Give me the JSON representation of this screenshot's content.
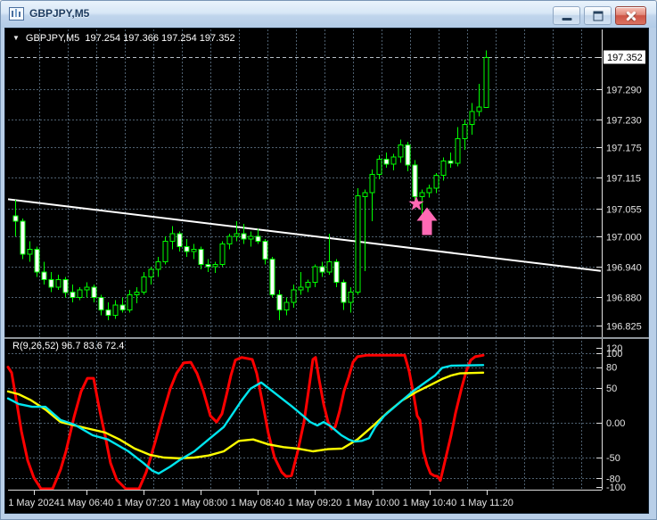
{
  "window": {
    "title": "GBPJPY,M5",
    "icon": "candlestick-chart-icon",
    "controls": [
      {
        "id": "minimize",
        "icon": "minimize-icon"
      },
      {
        "id": "restore",
        "icon": "restore-icon"
      },
      {
        "id": "close",
        "icon": "close-icon"
      }
    ]
  },
  "main_chart": {
    "collapse_glyph": "▼",
    "symbol_line": "GBPJPY,M5  197.254 197.366 197.254 197.352",
    "ohlc": {
      "open": 197.254,
      "high": 197.366,
      "low": 197.254,
      "close": 197.352
    },
    "current_price": "197.352",
    "price_axis_labels": [
      "197.290",
      "197.230",
      "197.175",
      "197.115",
      "197.055",
      "197.000",
      "196.940",
      "196.880",
      "196.825"
    ],
    "trendline": {
      "color": "#FFFFFF",
      "from_price": 197.073,
      "to_price": 196.932
    },
    "markers": {
      "star": {
        "x": 466,
        "y": 227.5,
        "color": "#FF69B4"
      },
      "arrow_up": {
        "x": 478,
        "tip_y": 231.5,
        "color": "#FF69B4"
      }
    }
  },
  "indicator": {
    "label": "R(9,26,52) 96.7 83.6 72.4",
    "values": [
      96.7,
      83.6,
      72.4
    ],
    "axis": [
      {
        "t": "120",
        "v": 120
      },
      {
        "t": "100",
        "v": 100
      },
      {
        "t": "80",
        "v": 80
      },
      {
        "t": "50",
        "v": 50
      },
      {
        "t": "0.00",
        "v": 0
      },
      {
        "t": "-50",
        "v": -50
      },
      {
        "t": "-80",
        "v": -80
      },
      {
        "t": "-100",
        "v": -100
      }
    ]
  },
  "time_axis": {
    "labels": [
      "1 May 2024",
      "1 May 06:40",
      "1 May 07:20",
      "1 May 08:00",
      "1 May 08:40",
      "1 May 09:20",
      "1 May 10:00",
      "1 May 10:40",
      "1 May 11:20"
    ]
  },
  "chart_data": {
    "type": "candlestick",
    "symbol": "GBPJPY",
    "timeframe": "M5",
    "price_range": [
      196.8,
      197.4
    ],
    "candles": [
      [
        197.04,
        197.072,
        197.0,
        197.03
      ],
      [
        197.03,
        197.035,
        196.955,
        196.965
      ],
      [
        196.965,
        196.99,
        196.95,
        196.975
      ],
      [
        196.975,
        196.98,
        196.92,
        196.93
      ],
      [
        196.93,
        196.95,
        196.905,
        196.915
      ],
      [
        196.915,
        196.93,
        196.89,
        196.9
      ],
      [
        196.9,
        196.925,
        196.895,
        196.915
      ],
      [
        196.915,
        196.92,
        196.88,
        196.89
      ],
      [
        196.89,
        196.905,
        196.87,
        196.88
      ],
      [
        196.88,
        196.9,
        196.875,
        196.895
      ],
      [
        196.895,
        196.91,
        196.88,
        196.9
      ],
      [
        196.9,
        196.905,
        196.87,
        196.88
      ],
      [
        196.88,
        196.885,
        196.845,
        196.855
      ],
      [
        196.855,
        196.87,
        196.835,
        196.845
      ],
      [
        196.845,
        196.875,
        196.838,
        196.865
      ],
      [
        196.865,
        196.88,
        196.85,
        196.855
      ],
      [
        196.855,
        196.895,
        196.85,
        196.885
      ],
      [
        196.885,
        196.9,
        196.868,
        196.89
      ],
      [
        196.89,
        196.93,
        196.885,
        196.92
      ],
      [
        196.92,
        196.94,
        196.905,
        196.935
      ],
      [
        196.935,
        196.96,
        196.92,
        196.95
      ],
      [
        196.95,
        197.0,
        196.945,
        196.99
      ],
      [
        196.99,
        197.02,
        196.975,
        197.005
      ],
      [
        197.005,
        197.01,
        196.97,
        196.98
      ],
      [
        196.98,
        196.995,
        196.96,
        196.97
      ],
      [
        196.97,
        196.985,
        196.955,
        196.975
      ],
      [
        196.975,
        196.98,
        196.935,
        196.945
      ],
      [
        196.945,
        196.955,
        196.93,
        196.94
      ],
      [
        196.94,
        196.95,
        196.928,
        196.945
      ],
      [
        196.945,
        196.99,
        196.94,
        196.985
      ],
      [
        196.985,
        197.005,
        196.975,
        197.0
      ],
      [
        197.0,
        197.03,
        196.99,
        197.005
      ],
      [
        197.005,
        197.025,
        196.985,
        196.995
      ],
      [
        196.995,
        197.01,
        196.98,
        197.0
      ],
      [
        197.0,
        197.015,
        196.985,
        196.99
      ],
      [
        196.99,
        196.995,
        196.945,
        196.955
      ],
      [
        196.955,
        196.96,
        196.88,
        196.885
      ],
      [
        196.885,
        196.895,
        196.835,
        196.855
      ],
      [
        196.855,
        196.88,
        196.845,
        196.87
      ],
      [
        196.87,
        196.905,
        196.86,
        196.895
      ],
      [
        196.895,
        196.93,
        196.885,
        196.9
      ],
      [
        196.9,
        196.915,
        196.89,
        196.91
      ],
      [
        196.91,
        196.945,
        196.9,
        196.94
      ],
      [
        196.94,
        196.95,
        196.92,
        196.93
      ],
      [
        196.93,
        197.005,
        196.925,
        196.95
      ],
      [
        196.95,
        196.955,
        196.9,
        196.91
      ],
      [
        196.91,
        196.915,
        196.855,
        196.87
      ],
      [
        196.87,
        196.9,
        196.85,
        196.89
      ],
      [
        196.89,
        197.095,
        196.885,
        197.08
      ],
      [
        197.078,
        197.092,
        196.932,
        197.086
      ],
      [
        197.086,
        197.132,
        197.03,
        197.122
      ],
      [
        197.122,
        197.16,
        197.112,
        197.152
      ],
      [
        197.152,
        197.165,
        197.135,
        197.142
      ],
      [
        197.142,
        197.162,
        197.13,
        197.156
      ],
      [
        197.156,
        197.19,
        197.145,
        197.18
      ],
      [
        197.18,
        197.186,
        197.128,
        197.14
      ],
      [
        197.14,
        197.15,
        197.068,
        197.078
      ],
      [
        197.078,
        197.092,
        197.044,
        197.086
      ],
      [
        197.086,
        197.102,
        197.076,
        197.095
      ],
      [
        197.095,
        197.125,
        197.085,
        197.12
      ],
      [
        197.12,
        197.155,
        197.11,
        197.148
      ],
      [
        197.148,
        197.165,
        197.135,
        197.144
      ],
      [
        197.144,
        197.215,
        197.138,
        197.192
      ],
      [
        197.192,
        197.23,
        197.17,
        197.22
      ],
      [
        197.22,
        197.262,
        197.2,
        197.246
      ],
      [
        197.246,
        197.3,
        197.236,
        197.254
      ],
      [
        197.254,
        197.366,
        197.254,
        197.352
      ]
    ],
    "oscillator": {
      "name": "R(9,26,52)",
      "levels": [
        100,
        80,
        50,
        0,
        -50,
        -80,
        -100
      ],
      "range": [
        -120,
        120
      ],
      "series": [
        {
          "name": "R9",
          "color": "#FF0000",
          "width": 3,
          "points": [
            [
              8,
              80
            ],
            [
              12,
              72
            ],
            [
              18,
              27
            ],
            [
              23,
              -12
            ],
            [
              30,
              -54
            ],
            [
              37,
              -79
            ],
            [
              45,
              -95
            ],
            [
              58,
              -97
            ],
            [
              67,
              -67
            ],
            [
              73,
              -41
            ],
            [
              82,
              8
            ],
            [
              90,
              45
            ],
            [
              97,
              64
            ],
            [
              104,
              64
            ],
            [
              110,
              23
            ],
            [
              117,
              -19
            ],
            [
              123,
              -58
            ],
            [
              130,
              -82
            ],
            [
              140,
              -95
            ],
            [
              155,
              -97
            ],
            [
              163,
              -71
            ],
            [
              173,
              -28
            ],
            [
              182,
              14
            ],
            [
              190,
              49
            ],
            [
              197,
              71
            ],
            [
              205,
              86
            ],
            [
              213,
              87
            ],
            [
              220,
              71
            ],
            [
              227,
              46
            ],
            [
              235,
              10
            ],
            [
              242,
              1
            ],
            [
              248,
              13
            ],
            [
              254,
              45
            ],
            [
              258,
              68
            ],
            [
              263,
              90
            ],
            [
              270,
              94
            ],
            [
              282,
              91
            ],
            [
              287,
              71
            ],
            [
              295,
              19
            ],
            [
              300,
              -15
            ],
            [
              307,
              -50
            ],
            [
              315,
              -71
            ],
            [
              320,
              -77
            ],
            [
              326,
              -76
            ],
            [
              333,
              -41
            ],
            [
              340,
              1
            ],
            [
              345,
              45
            ],
            [
              350,
              91
            ],
            [
              353,
              94
            ],
            [
              357,
              62
            ],
            [
              362,
              27
            ],
            [
              367,
              1
            ],
            [
              371,
              -9
            ],
            [
              375,
              -6
            ],
            [
              380,
              17
            ],
            [
              385,
              46
            ],
            [
              390,
              65
            ],
            [
              395,
              87
            ],
            [
              400,
              95
            ],
            [
              410,
              97
            ],
            [
              453,
              97
            ],
            [
              458,
              74
            ],
            [
              463,
              40
            ],
            [
              467,
              10
            ],
            [
              470,
              4
            ],
            [
              474,
              -41
            ],
            [
              478,
              -60
            ],
            [
              482,
              -73
            ],
            [
              486,
              -76
            ],
            [
              490,
              -77
            ],
            [
              493,
              -83
            ],
            [
              498,
              -56
            ],
            [
              505,
              -18
            ],
            [
              510,
              14
            ],
            [
              517,
              51
            ],
            [
              522,
              74
            ],
            [
              527,
              90
            ],
            [
              532,
              95
            ],
            [
              541,
              97
            ]
          ]
        },
        {
          "name": "R52",
          "color": "#FFFF00",
          "width": 2.4,
          "points": [
            [
              8,
              45
            ],
            [
              20,
              41
            ],
            [
              33,
              33
            ],
            [
              50,
              19
            ],
            [
              67,
              1
            ],
            [
              83,
              -4
            ],
            [
              100,
              -9
            ],
            [
              117,
              -14
            ],
            [
              133,
              -24
            ],
            [
              150,
              -37
            ],
            [
              167,
              -46
            ],
            [
              183,
              -50
            ],
            [
              200,
              -51
            ],
            [
              217,
              -50
            ],
            [
              233,
              -47
            ],
            [
              250,
              -41
            ],
            [
              267,
              -26
            ],
            [
              283,
              -24
            ],
            [
              300,
              -31
            ],
            [
              317,
              -35
            ],
            [
              333,
              -37
            ],
            [
              350,
              -41
            ],
            [
              367,
              -38
            ],
            [
              383,
              -37
            ],
            [
              400,
              -24
            ],
            [
              417,
              -5
            ],
            [
              433,
              14
            ],
            [
              450,
              32
            ],
            [
              467,
              45
            ],
            [
              483,
              55
            ],
            [
              495,
              63
            ],
            [
              505,
              68
            ],
            [
              515,
              71
            ],
            [
              541,
              72
            ]
          ]
        },
        {
          "name": "R26",
          "color": "#00E5EE",
          "width": 2.4,
          "points": [
            [
              8,
              35
            ],
            [
              20,
              27
            ],
            [
              35,
              23
            ],
            [
              50,
              23
            ],
            [
              67,
              4
            ],
            [
              83,
              -3
            ],
            [
              103,
              -18
            ],
            [
              120,
              -24
            ],
            [
              143,
              -41
            ],
            [
              160,
              -58
            ],
            [
              170,
              -69
            ],
            [
              177,
              -73
            ],
            [
              190,
              -63
            ],
            [
              200,
              -54
            ],
            [
              217,
              -41
            ],
            [
              233,
              -24
            ],
            [
              250,
              -6
            ],
            [
              260,
              13
            ],
            [
              270,
              32
            ],
            [
              280,
              49
            ],
            [
              292,
              58
            ],
            [
              300,
              50
            ],
            [
              310,
              40
            ],
            [
              327,
              23
            ],
            [
              340,
              9
            ],
            [
              347,
              1
            ],
            [
              355,
              -4
            ],
            [
              362,
              1
            ],
            [
              370,
              -5
            ],
            [
              382,
              -18
            ],
            [
              390,
              -24
            ],
            [
              397,
              -27
            ],
            [
              405,
              -26
            ],
            [
              413,
              -22
            ],
            [
              420,
              -6
            ],
            [
              430,
              10
            ],
            [
              440,
              21
            ],
            [
              450,
              32
            ],
            [
              463,
              46
            ],
            [
              477,
              59
            ],
            [
              487,
              68
            ],
            [
              495,
              79
            ],
            [
              505,
              82
            ],
            [
              541,
              83
            ]
          ]
        }
      ]
    }
  },
  "colors": {
    "background": "#000000",
    "grid": "#4E6070",
    "candle_border": "#00FF00",
    "bull_fill": "#000000",
    "bear_fill": "#FFFFFF",
    "current_price_line": "#B6BEC6",
    "frame": "#E0E0E0",
    "separator": "#8F959B",
    "axis_text": "#E4E4E4",
    "marker": "#FF69B4"
  }
}
